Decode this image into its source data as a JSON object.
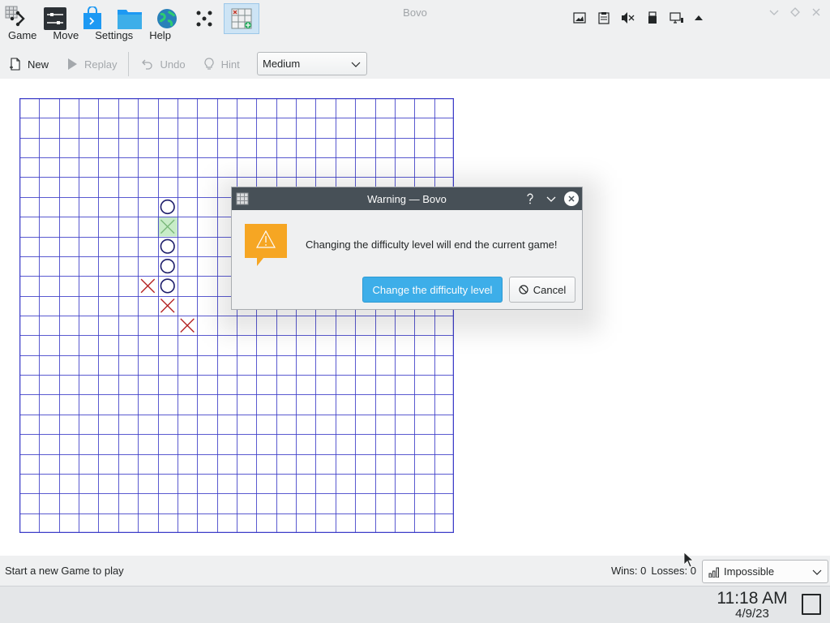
{
  "window": {
    "title": "Bovo"
  },
  "menubar": {
    "items": [
      "Game",
      "Move",
      "Settings",
      "Help"
    ]
  },
  "toolbar": {
    "new_label": "New",
    "replay_label": "Replay",
    "undo_label": "Undo",
    "hint_label": "Hint",
    "difficulty_value": "Medium"
  },
  "board": {
    "grid_size": 22,
    "line_color": "#3d3dc8",
    "o_color": "#1d1d6b",
    "x_color": "#b42323",
    "highlight_color": "#c8ecc8",
    "pieces": [
      {
        "type": "O",
        "col": 7,
        "row": 5
      },
      {
        "type": "X",
        "col": 7,
        "row": 6,
        "highlight": true
      },
      {
        "type": "O",
        "col": 7,
        "row": 7
      },
      {
        "type": "O",
        "col": 7,
        "row": 8
      },
      {
        "type": "X",
        "col": 6,
        "row": 9
      },
      {
        "type": "O",
        "col": 7,
        "row": 9
      },
      {
        "type": "X",
        "col": 7,
        "row": 10
      },
      {
        "type": "X",
        "col": 8,
        "row": 11
      }
    ]
  },
  "statusbar": {
    "message": "Start a new Game to play",
    "wins": "Wins: 0",
    "losses": "Losses: 0",
    "player_skill": "Impossible"
  },
  "dialog": {
    "title": "Warning — Bovo",
    "message": "Changing the difficulty level will end the current game!",
    "confirm_label": "Change the difficulty level",
    "cancel_label": "Cancel"
  },
  "taskbar": {
    "clock_time": "11:18 AM",
    "clock_date": "4/9/23"
  },
  "colors": {
    "accent": "#3daee9",
    "dialog_titlebar": "#475057",
    "warning": "#f6a623"
  }
}
